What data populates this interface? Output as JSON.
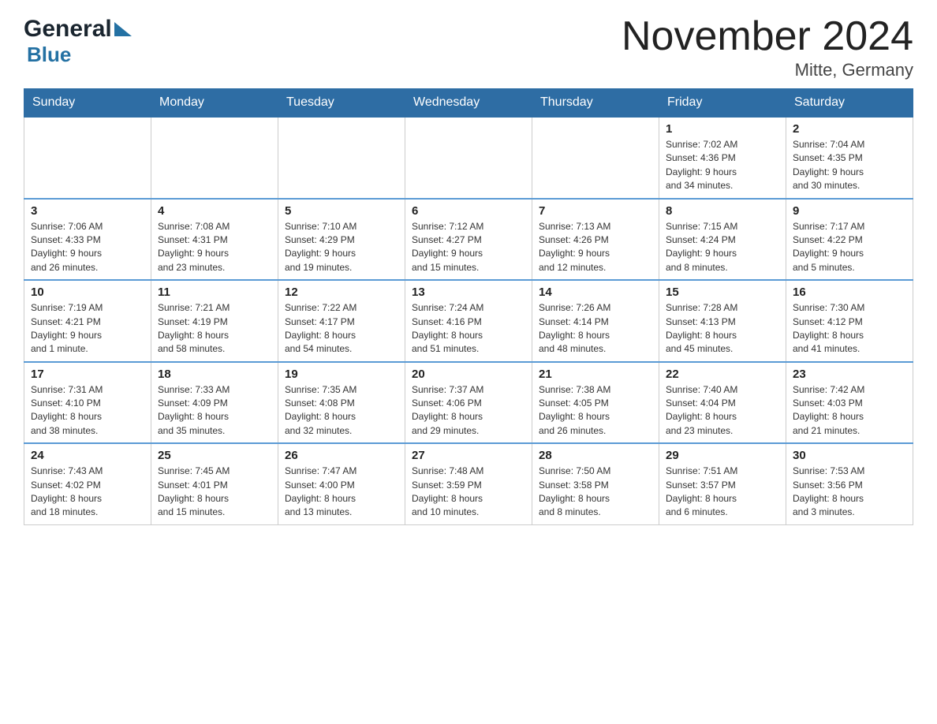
{
  "header": {
    "logo_general": "General",
    "logo_blue": "Blue",
    "month_title": "November 2024",
    "location": "Mitte, Germany"
  },
  "weekdays": [
    "Sunday",
    "Monday",
    "Tuesday",
    "Wednesday",
    "Thursday",
    "Friday",
    "Saturday"
  ],
  "weeks": [
    [
      {
        "day": "",
        "info": ""
      },
      {
        "day": "",
        "info": ""
      },
      {
        "day": "",
        "info": ""
      },
      {
        "day": "",
        "info": ""
      },
      {
        "day": "",
        "info": ""
      },
      {
        "day": "1",
        "info": "Sunrise: 7:02 AM\nSunset: 4:36 PM\nDaylight: 9 hours\nand 34 minutes."
      },
      {
        "day": "2",
        "info": "Sunrise: 7:04 AM\nSunset: 4:35 PM\nDaylight: 9 hours\nand 30 minutes."
      }
    ],
    [
      {
        "day": "3",
        "info": "Sunrise: 7:06 AM\nSunset: 4:33 PM\nDaylight: 9 hours\nand 26 minutes."
      },
      {
        "day": "4",
        "info": "Sunrise: 7:08 AM\nSunset: 4:31 PM\nDaylight: 9 hours\nand 23 minutes."
      },
      {
        "day": "5",
        "info": "Sunrise: 7:10 AM\nSunset: 4:29 PM\nDaylight: 9 hours\nand 19 minutes."
      },
      {
        "day": "6",
        "info": "Sunrise: 7:12 AM\nSunset: 4:27 PM\nDaylight: 9 hours\nand 15 minutes."
      },
      {
        "day": "7",
        "info": "Sunrise: 7:13 AM\nSunset: 4:26 PM\nDaylight: 9 hours\nand 12 minutes."
      },
      {
        "day": "8",
        "info": "Sunrise: 7:15 AM\nSunset: 4:24 PM\nDaylight: 9 hours\nand 8 minutes."
      },
      {
        "day": "9",
        "info": "Sunrise: 7:17 AM\nSunset: 4:22 PM\nDaylight: 9 hours\nand 5 minutes."
      }
    ],
    [
      {
        "day": "10",
        "info": "Sunrise: 7:19 AM\nSunset: 4:21 PM\nDaylight: 9 hours\nand 1 minute."
      },
      {
        "day": "11",
        "info": "Sunrise: 7:21 AM\nSunset: 4:19 PM\nDaylight: 8 hours\nand 58 minutes."
      },
      {
        "day": "12",
        "info": "Sunrise: 7:22 AM\nSunset: 4:17 PM\nDaylight: 8 hours\nand 54 minutes."
      },
      {
        "day": "13",
        "info": "Sunrise: 7:24 AM\nSunset: 4:16 PM\nDaylight: 8 hours\nand 51 minutes."
      },
      {
        "day": "14",
        "info": "Sunrise: 7:26 AM\nSunset: 4:14 PM\nDaylight: 8 hours\nand 48 minutes."
      },
      {
        "day": "15",
        "info": "Sunrise: 7:28 AM\nSunset: 4:13 PM\nDaylight: 8 hours\nand 45 minutes."
      },
      {
        "day": "16",
        "info": "Sunrise: 7:30 AM\nSunset: 4:12 PM\nDaylight: 8 hours\nand 41 minutes."
      }
    ],
    [
      {
        "day": "17",
        "info": "Sunrise: 7:31 AM\nSunset: 4:10 PM\nDaylight: 8 hours\nand 38 minutes."
      },
      {
        "day": "18",
        "info": "Sunrise: 7:33 AM\nSunset: 4:09 PM\nDaylight: 8 hours\nand 35 minutes."
      },
      {
        "day": "19",
        "info": "Sunrise: 7:35 AM\nSunset: 4:08 PM\nDaylight: 8 hours\nand 32 minutes."
      },
      {
        "day": "20",
        "info": "Sunrise: 7:37 AM\nSunset: 4:06 PM\nDaylight: 8 hours\nand 29 minutes."
      },
      {
        "day": "21",
        "info": "Sunrise: 7:38 AM\nSunset: 4:05 PM\nDaylight: 8 hours\nand 26 minutes."
      },
      {
        "day": "22",
        "info": "Sunrise: 7:40 AM\nSunset: 4:04 PM\nDaylight: 8 hours\nand 23 minutes."
      },
      {
        "day": "23",
        "info": "Sunrise: 7:42 AM\nSunset: 4:03 PM\nDaylight: 8 hours\nand 21 minutes."
      }
    ],
    [
      {
        "day": "24",
        "info": "Sunrise: 7:43 AM\nSunset: 4:02 PM\nDaylight: 8 hours\nand 18 minutes."
      },
      {
        "day": "25",
        "info": "Sunrise: 7:45 AM\nSunset: 4:01 PM\nDaylight: 8 hours\nand 15 minutes."
      },
      {
        "day": "26",
        "info": "Sunrise: 7:47 AM\nSunset: 4:00 PM\nDaylight: 8 hours\nand 13 minutes."
      },
      {
        "day": "27",
        "info": "Sunrise: 7:48 AM\nSunset: 3:59 PM\nDaylight: 8 hours\nand 10 minutes."
      },
      {
        "day": "28",
        "info": "Sunrise: 7:50 AM\nSunset: 3:58 PM\nDaylight: 8 hours\nand 8 minutes."
      },
      {
        "day": "29",
        "info": "Sunrise: 7:51 AM\nSunset: 3:57 PM\nDaylight: 8 hours\nand 6 minutes."
      },
      {
        "day": "30",
        "info": "Sunrise: 7:53 AM\nSunset: 3:56 PM\nDaylight: 8 hours\nand 3 minutes."
      }
    ]
  ]
}
